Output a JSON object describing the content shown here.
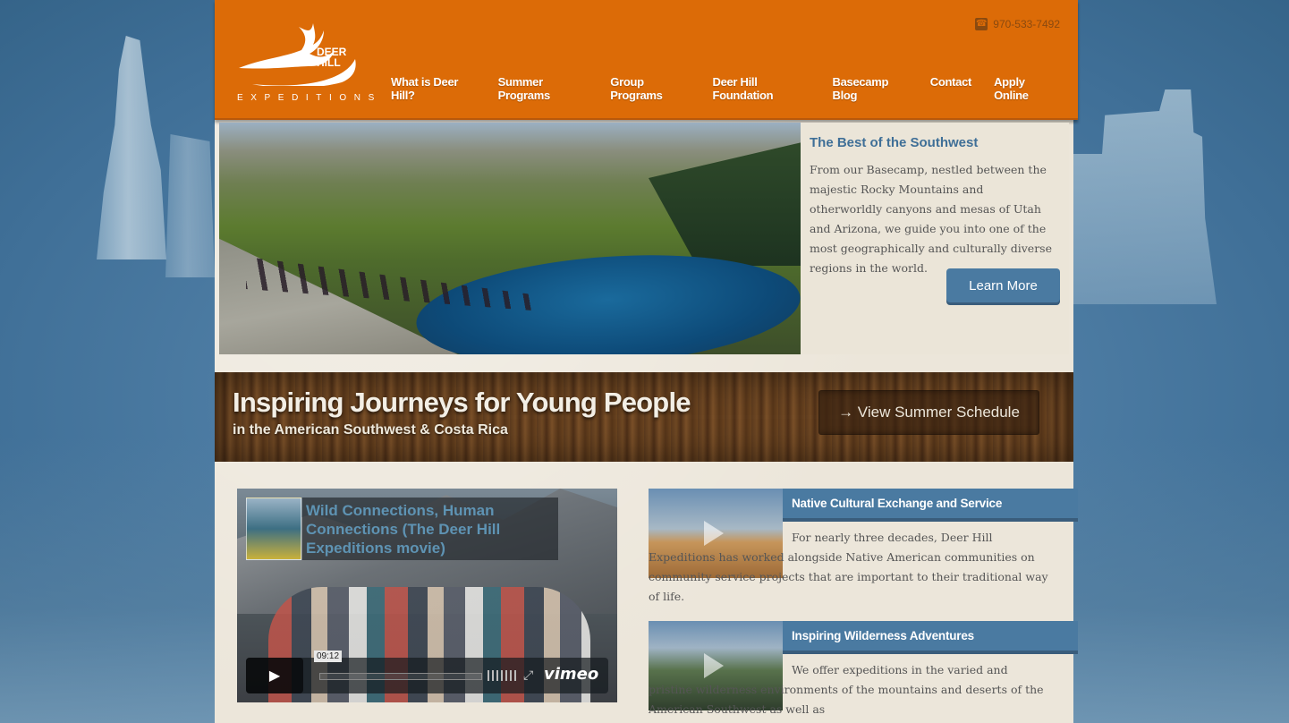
{
  "site": {
    "logo_name": "DEER HILL",
    "logo_tagline": "EXPEDITIONS",
    "phone": "970-533-7492"
  },
  "nav": {
    "items": [
      {
        "label": "What is Deer Hill?"
      },
      {
        "label": "Summer Programs"
      },
      {
        "label": "Group Programs"
      },
      {
        "label": "Deer Hill Foundation"
      },
      {
        "label": "Basecamp Blog"
      },
      {
        "label": "Contact"
      },
      {
        "label": "Apply Online"
      }
    ]
  },
  "hero": {
    "title": "The Best of the Southwest",
    "text": "From our Basecamp, nestled between the majestic Rocky Mountains and otherworldly canyons and mesas of Utah and Arizona, we guide you into one of the most geographically and culturally diverse regions in the world.",
    "button_label": "Learn More"
  },
  "banner": {
    "title": "Inspiring Journeys for Young People",
    "subtitle": "in the American Southwest & Costa Rica",
    "button_label": "→ View Summer Schedule"
  },
  "video": {
    "title": "Wild Connections, Human Connections (The Deer Hill Expeditions movie)",
    "time": "09:12",
    "provider": "vimeo"
  },
  "features": [
    {
      "title": "Native Cultural Exchange and Service",
      "text": "For nearly three decades, Deer Hill Expeditions has worked alongside Native American communities on community service projects that are important to their traditional way of life."
    },
    {
      "title": "Inspiring Wilderness Adventures",
      "text": "We offer expeditions in the varied and pristine wilderness environments of the mountains and deserts of the American Southwest as well as"
    }
  ],
  "colors": {
    "header_orange": "#dc6b07",
    "accent_blue": "#4a7aa1",
    "background_blue": "#4f7ea5"
  }
}
